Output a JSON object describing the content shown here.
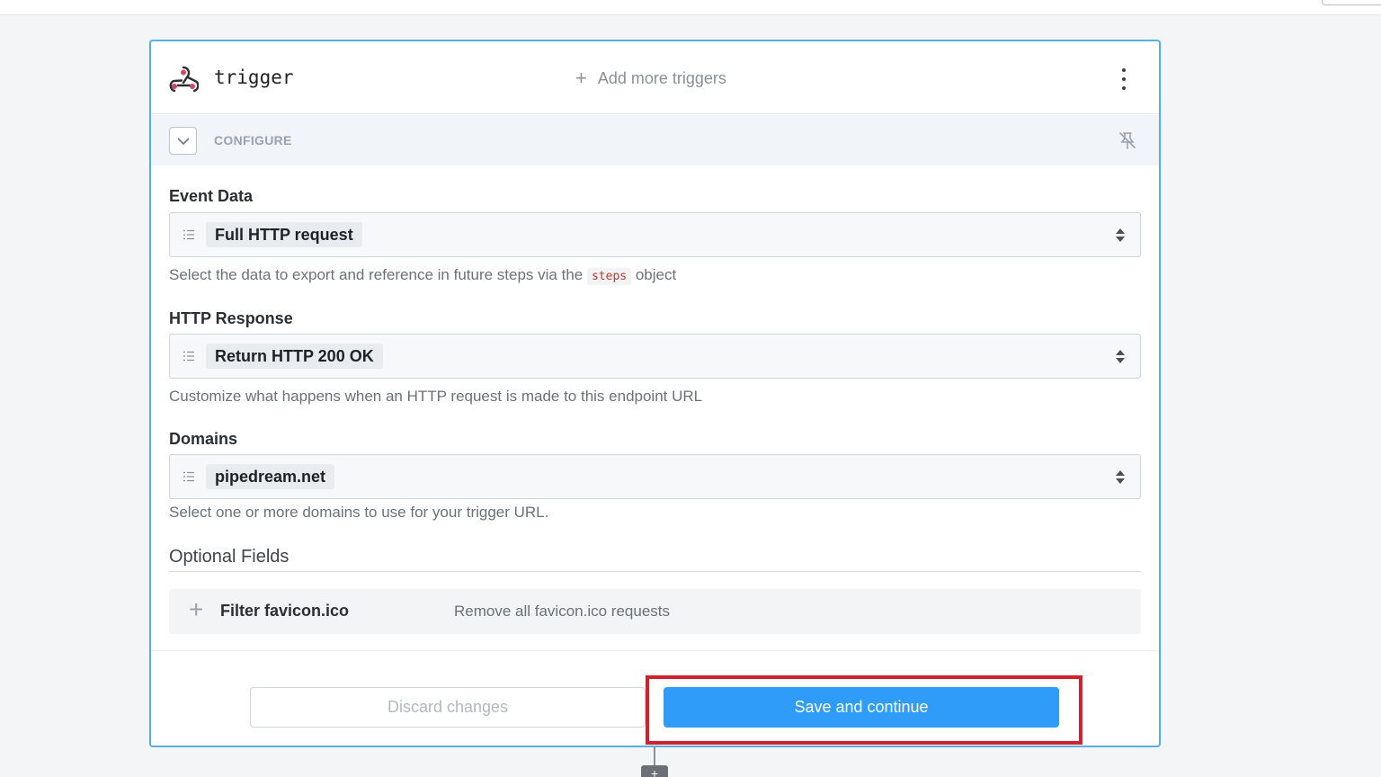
{
  "header": {
    "title": "trigger",
    "add_triggers_label": "Add more triggers",
    "menu_icon": "kebab-menu-icon",
    "trigger_icon": "webhook-icon"
  },
  "configure": {
    "label": "CONFIGURE",
    "collapse_icon": "chevron-down-icon",
    "pin_icon": "unpin-icon"
  },
  "fields": {
    "event_data": {
      "label": "Event Data",
      "value": "Full HTTP request",
      "help_before": "Select the data to export and reference in future steps via the",
      "help_code": "steps",
      "help_after": "object"
    },
    "http_response": {
      "label": "HTTP Response",
      "value": "Return HTTP 200 OK",
      "help": "Customize what happens when an HTTP request is made to this endpoint URL"
    },
    "domains": {
      "label": "Domains",
      "value": "pipedream.net",
      "help": "Select one or more domains to use for your trigger URL."
    }
  },
  "optional": {
    "title": "Optional Fields",
    "items": [
      {
        "name": "Filter favicon.ico",
        "description": "Remove all favicon.ico requests"
      }
    ]
  },
  "footer": {
    "discard_label": "Discard changes",
    "save_label": "Save and continue"
  },
  "colors": {
    "accent": "#2e9cf8",
    "card_border": "#55aee6",
    "highlight": "#d0222e",
    "code_text": "#c0392b"
  }
}
